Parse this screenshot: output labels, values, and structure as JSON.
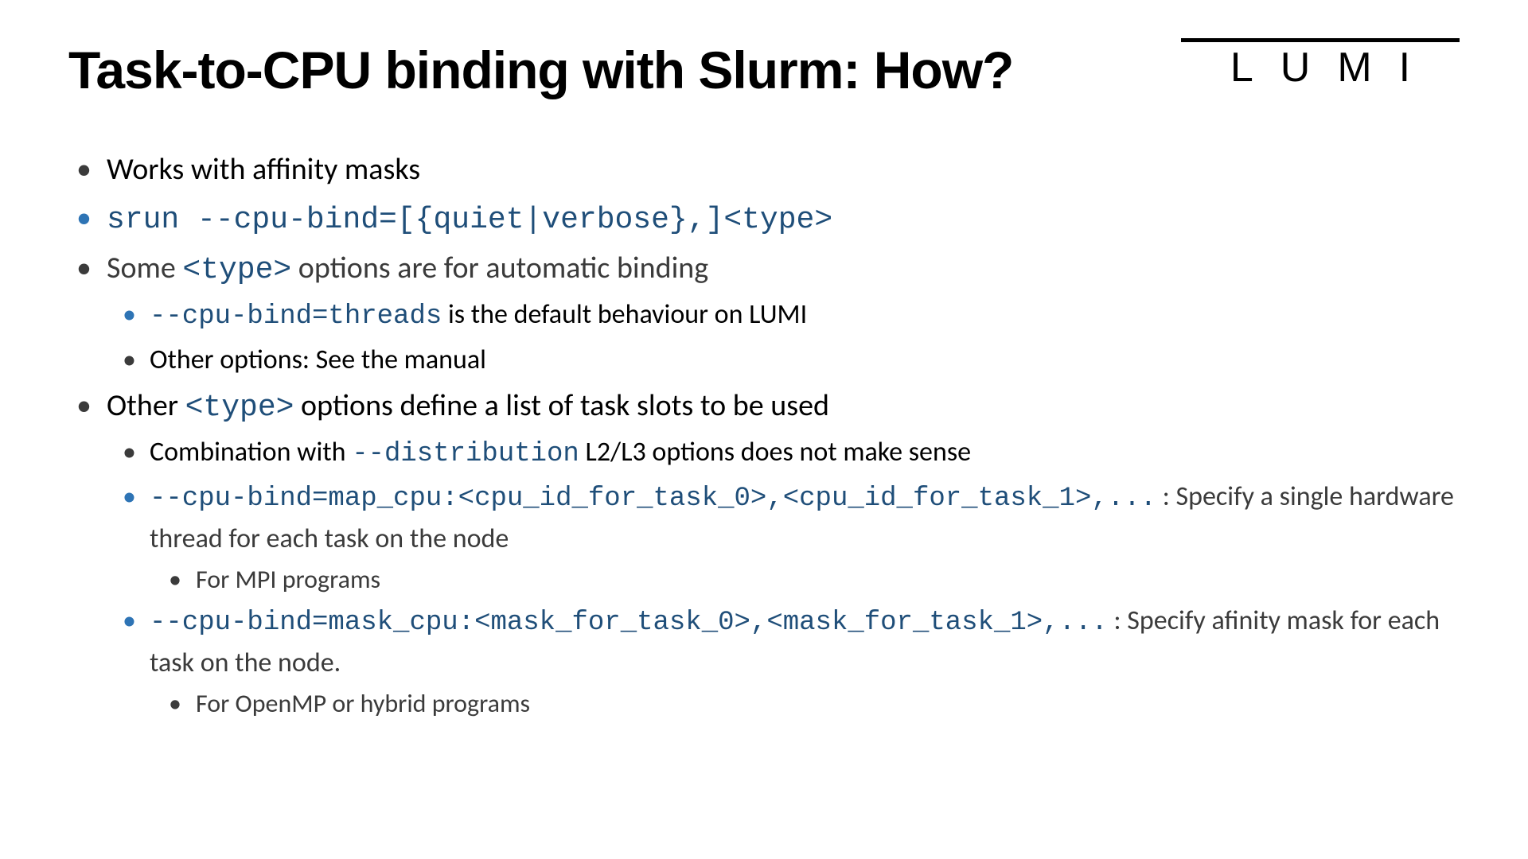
{
  "logo": "LUMI",
  "title": "Task-to-CPU binding with Slurm: How?",
  "b1": "Works with affinity masks",
  "b2_cmd": "srun --cpu-bind=[{quiet|verbose},]<type>",
  "b3_pre": "Some ",
  "b3_code": "<type>",
  "b3_post": " options are for automatic binding",
  "b3a_code": "--cpu-bind=threads",
  "b3a_post": " is the default behaviour on LUMI",
  "b3b": "Other options: See the manual",
  "b4_pre": "Other ",
  "b4_code": "<type>",
  "b4_post": " options define a list of task slots to be used",
  "b4a_pre": "Combination with ",
  "b4a_code": "--distribution",
  "b4a_post": " L2/L3 options does not make sense",
  "b4b_code": "--cpu-bind=map_cpu:<cpu_id_for_task_0>,<cpu_id_for_task_1>,...",
  "b4b_post": " : Specify a single hardware thread for each task on the node",
  "b4b_sub": "For MPI programs",
  "b4c_code": "--cpu-bind=mask_cpu:<mask_for_task_0>,<mask_for_task_1>,...",
  "b4c_post": " : Specify afinity mask for each task on the node.",
  "b4c_sub": "For OpenMP or hybrid programs"
}
